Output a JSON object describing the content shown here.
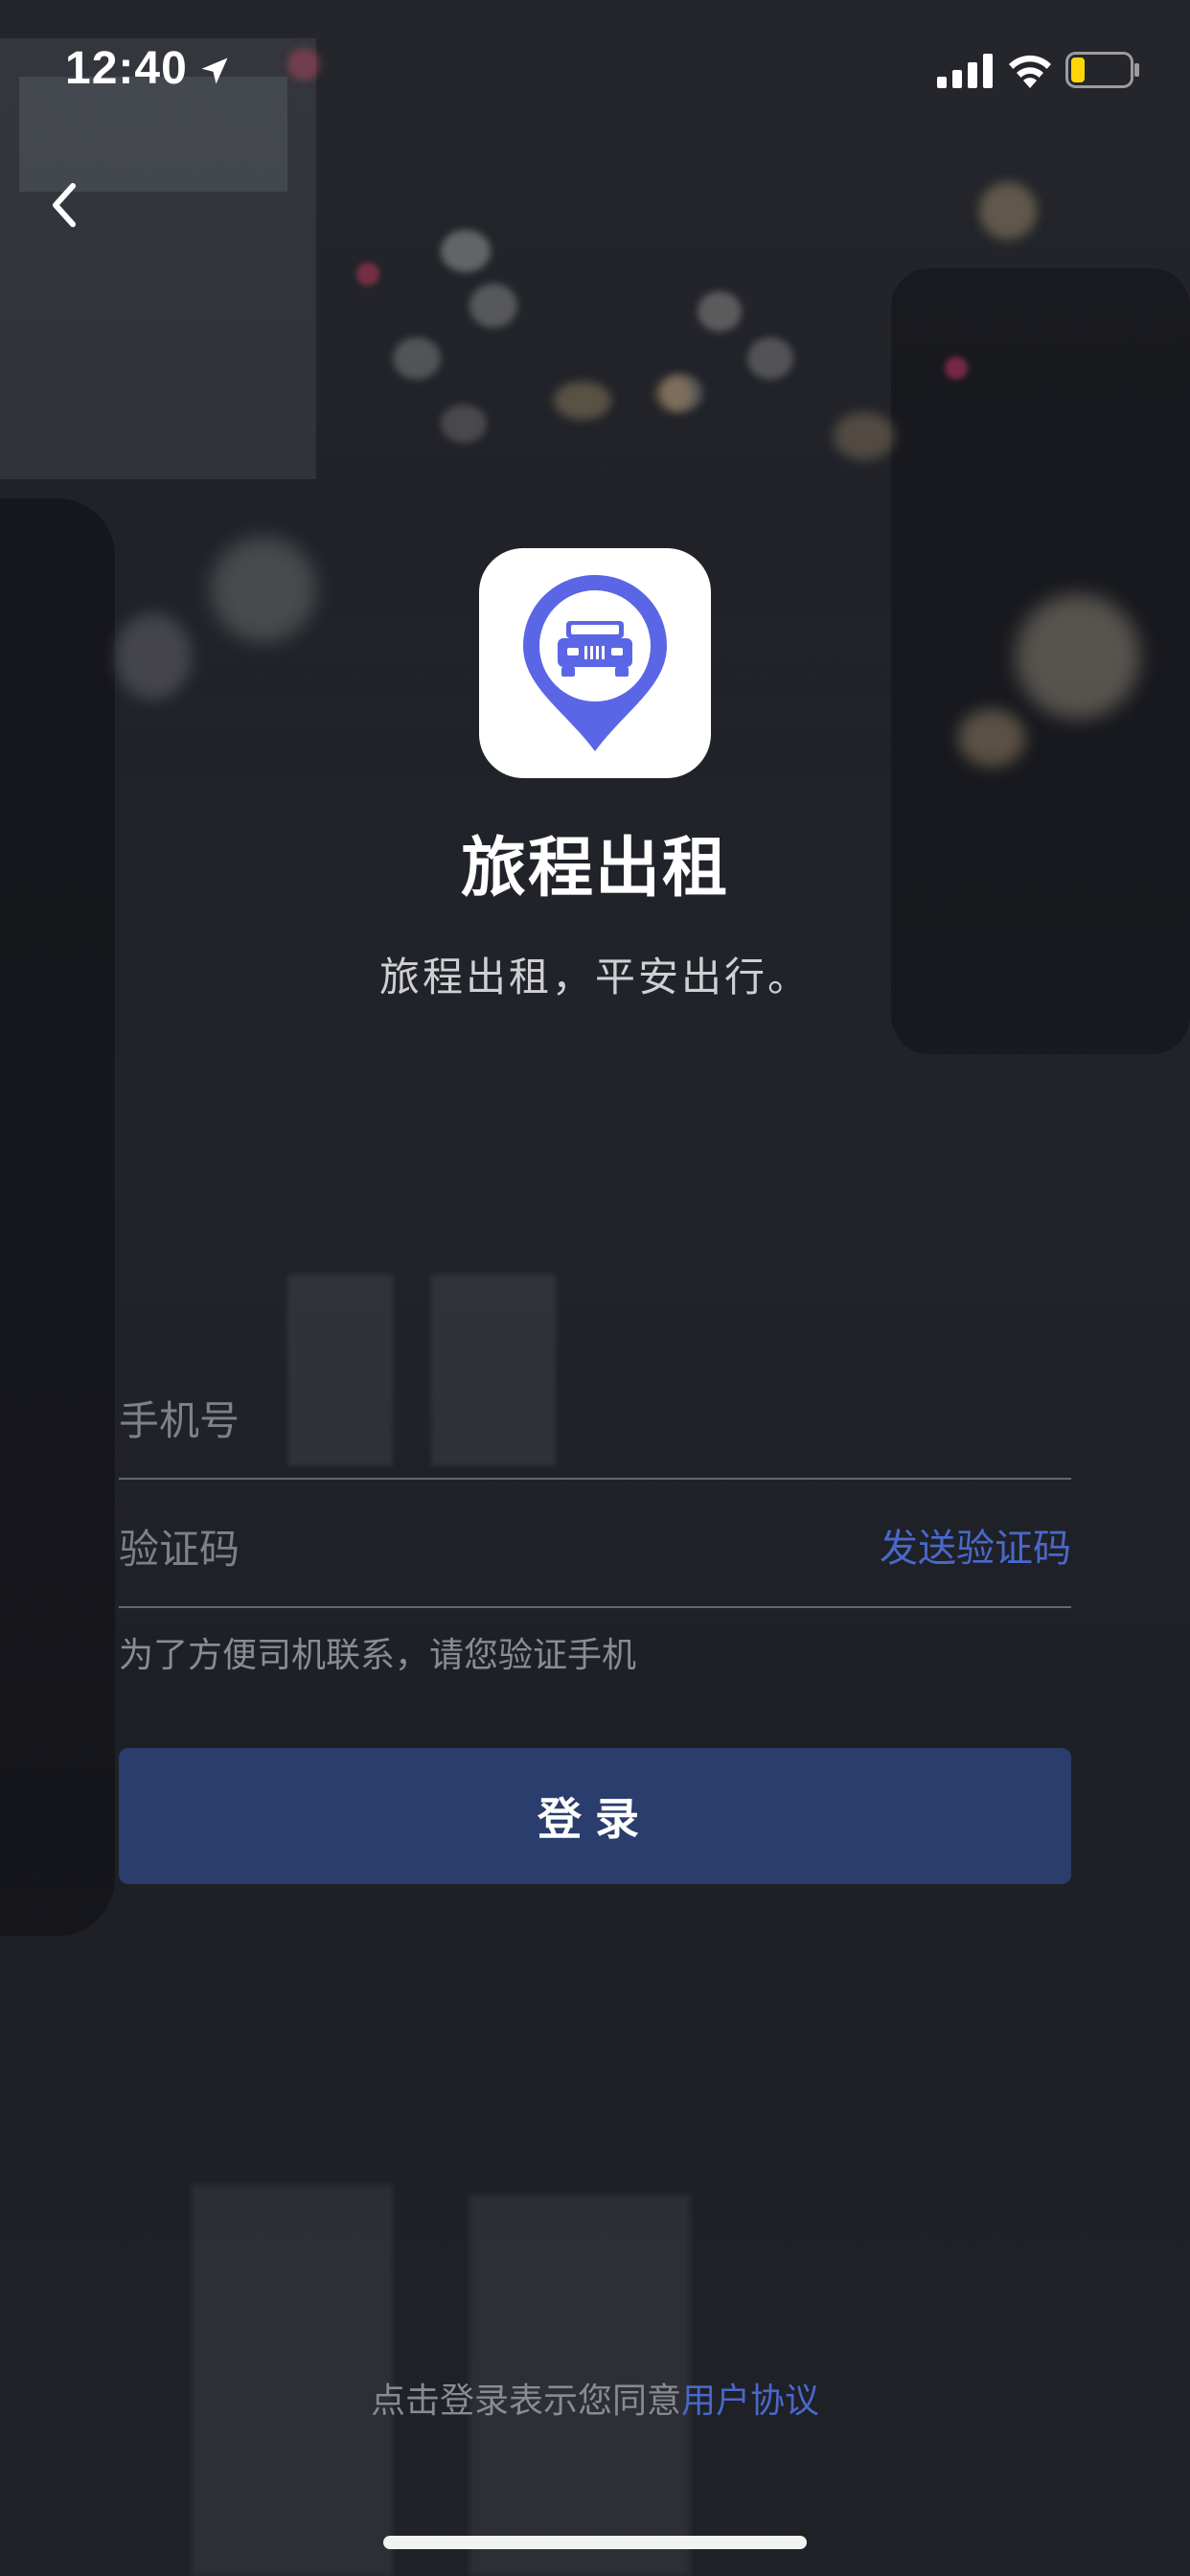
{
  "status_bar": {
    "time": "12:40",
    "icons": [
      "location-arrow-icon",
      "cellular-signal-icon",
      "wifi-icon",
      "battery-low-icon"
    ]
  },
  "nav": {
    "back_icon": "chevron-left-icon"
  },
  "app": {
    "icon": "taxi-location-pin-icon",
    "name": "旅程出租",
    "slogan": "旅程出租，平安出行。"
  },
  "form": {
    "phone_placeholder": "手机号",
    "phone_value": "",
    "code_placeholder": "验证码",
    "code_value": "",
    "send_code_label": "发送验证码",
    "hint": "为了方便司机联系，请您验证手机",
    "login_label": "登录"
  },
  "footer": {
    "agreement_prefix": "点击登录表示您同意",
    "agreement_link": "用户协议"
  },
  "colors": {
    "accent": "#4a68c9",
    "button_bg": "#2a3d6d",
    "icon_blue": "#5a66e6",
    "battery_warning": "#ffd60a"
  }
}
